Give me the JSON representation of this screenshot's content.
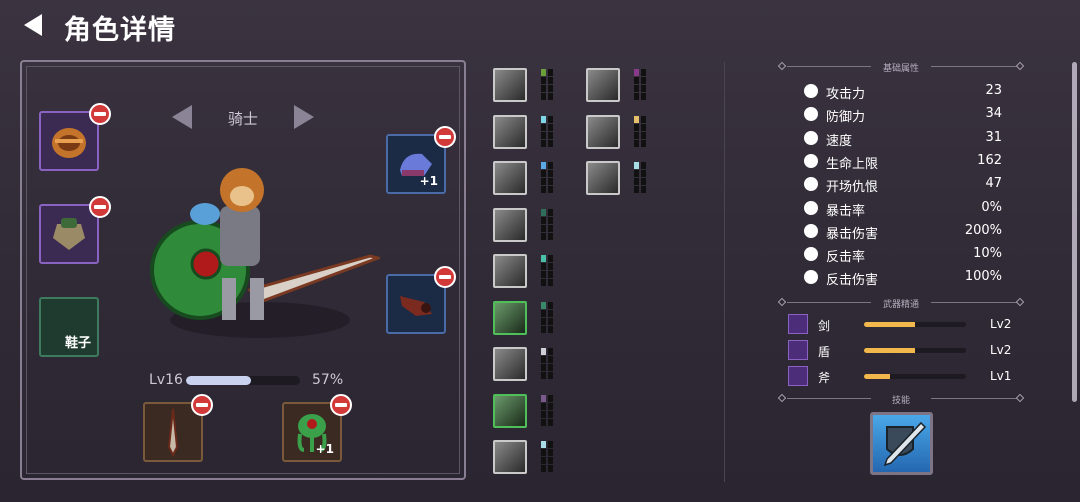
{
  "header": {
    "title": "角色详情"
  },
  "character": {
    "class_name": "骑士",
    "level": "Lv16",
    "xp_progress": 0.57,
    "xp_percent": "57%"
  },
  "equipment": {
    "left_slots": [
      {
        "name": "helmet",
        "rarity": "purple"
      },
      {
        "name": "armor",
        "rarity": "purple"
      },
      {
        "name": "shoes",
        "label": "鞋子",
        "rarity": "empty"
      }
    ],
    "right_slots": [
      {
        "name": "gauntlet",
        "plus": "+1",
        "rarity": "blue"
      },
      {
        "name": "bracer",
        "rarity": "blue"
      }
    ],
    "bottom_slots": [
      {
        "name": "weapon-sword",
        "rarity": "brown"
      },
      {
        "name": "shield-tentacle",
        "plus": "+1",
        "rarity": "brown"
      }
    ]
  },
  "skills_grid": {
    "col1": [
      {
        "icon": "berserker-icon",
        "pip_color": "#6aa03a"
      },
      {
        "icon": "strike-icon",
        "pip_color": "#7fd6e6"
      },
      {
        "icon": "burst-icon",
        "pip_color": "#5aa8e6"
      },
      {
        "icon": "charge-icon",
        "pip_color": "#2f6e5a"
      },
      {
        "icon": "eye-icon",
        "pip_color": "#49c0a8"
      },
      {
        "icon": "chest-icon",
        "pip_color": "#3a8a6a"
      },
      {
        "icon": "axe-swing-icon",
        "pip_color": "#cfcfd6"
      },
      {
        "icon": "beast-icon",
        "pip_color": "#7a5a8a"
      },
      {
        "icon": "slash-icon",
        "pip_color": "#a8dce6"
      }
    ],
    "col2": [
      {
        "icon": "hood-icon",
        "pip_color": "#8a3a8a"
      },
      {
        "icon": "claw-icon",
        "pip_color": "#e6c06a"
      },
      {
        "icon": "wings-icon",
        "pip_color": "#a8dce6"
      }
    ]
  },
  "base_stats": {
    "heading": "基础属性",
    "rows": [
      {
        "icon": "sword-icon",
        "label": "攻击力",
        "value": "23"
      },
      {
        "icon": "shield-icon",
        "label": "防御力",
        "value": "34"
      },
      {
        "icon": "boot-icon",
        "label": "速度",
        "value": "31"
      },
      {
        "icon": "heart-icon",
        "label": "生命上限",
        "value": "162"
      },
      {
        "icon": "skull-icon",
        "label": "开场仇恨",
        "value": "47"
      },
      {
        "icon": "crit-icon",
        "label": "暴击率",
        "value": "0%"
      },
      {
        "icon": "crit-damage-icon",
        "label": "暴击伤害",
        "value": "200%"
      },
      {
        "icon": "counter-icon",
        "label": "反击率",
        "value": "10%"
      },
      {
        "icon": "counter-damage-icon",
        "label": "反击伤害",
        "value": "100%"
      }
    ]
  },
  "weapon_mastery": {
    "heading": "武器精通",
    "rows": [
      {
        "icon": "sword-mastery-icon",
        "label": "剑",
        "progress": 0.5,
        "level": "Lv2"
      },
      {
        "icon": "shield-mastery-icon",
        "label": "盾",
        "progress": 0.5,
        "level": "Lv2"
      },
      {
        "icon": "axe-mastery-icon",
        "label": "斧",
        "progress": 0.25,
        "level": "Lv1"
      }
    ]
  },
  "abilities": {
    "heading": "技能",
    "main_icon": "shield-sword-skill-icon"
  }
}
